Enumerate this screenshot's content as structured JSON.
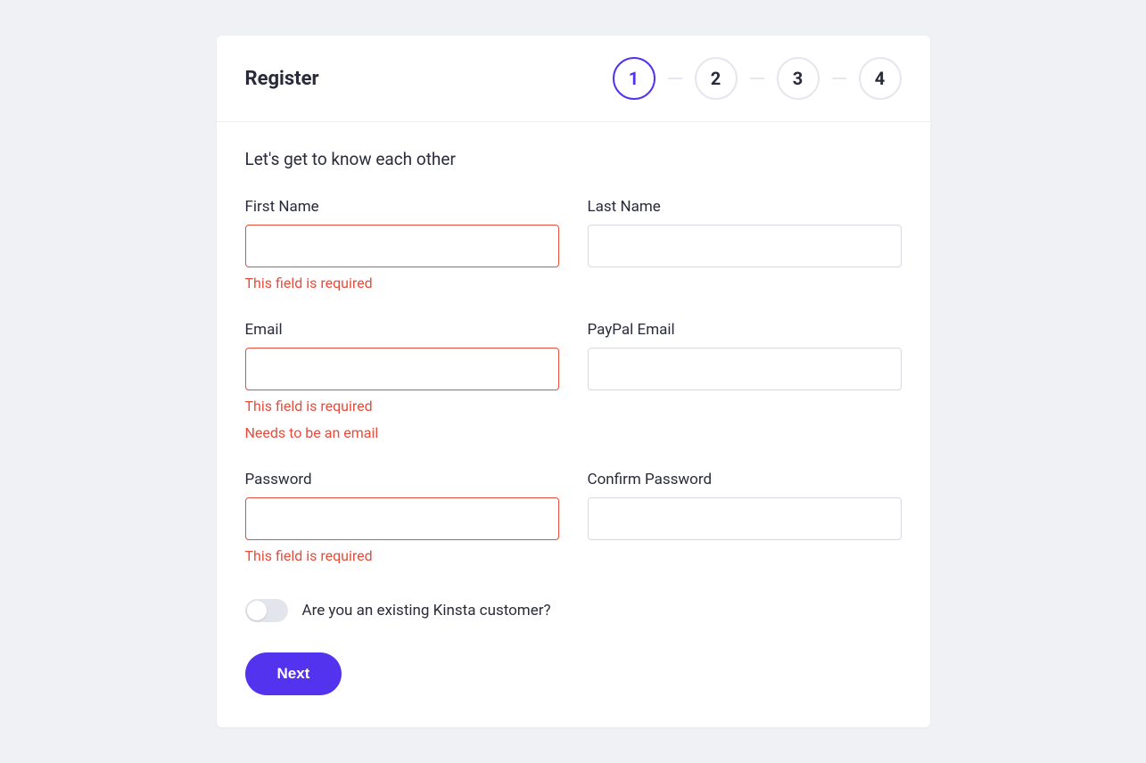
{
  "header": {
    "title": "Register"
  },
  "stepper": {
    "steps": [
      "1",
      "2",
      "3",
      "4"
    ],
    "active_index": 0
  },
  "form": {
    "subtitle": "Let's get to know each other",
    "fields": {
      "first_name": {
        "label": "First Name",
        "value": "",
        "errors": [
          "This field is required"
        ]
      },
      "last_name": {
        "label": "Last Name",
        "value": ""
      },
      "email": {
        "label": "Email",
        "value": "",
        "errors": [
          "This field is required",
          "Needs to be an email"
        ]
      },
      "paypal_email": {
        "label": "PayPal Email",
        "value": ""
      },
      "password": {
        "label": "Password",
        "value": "",
        "errors": [
          "This field is required"
        ]
      },
      "confirm_password": {
        "label": "Confirm Password",
        "value": ""
      }
    },
    "toggle": {
      "label": "Are you an existing Kinsta customer?",
      "value": false
    },
    "actions": {
      "next_label": "Next"
    }
  }
}
